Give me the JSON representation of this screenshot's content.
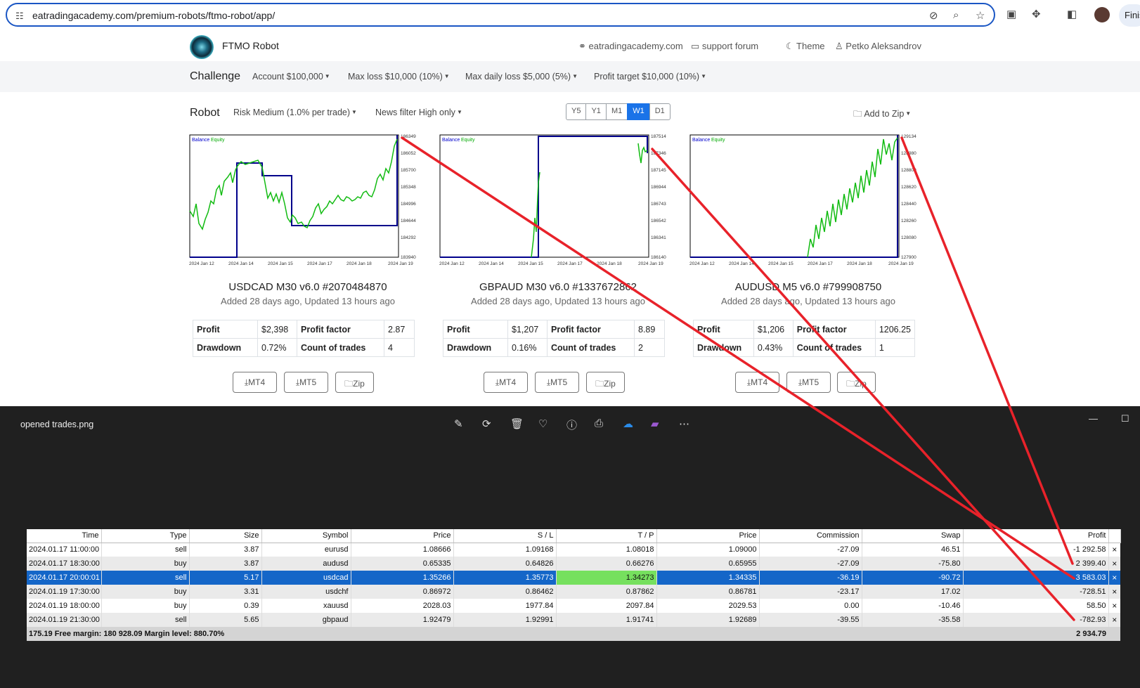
{
  "browser": {
    "url": "eatradingacademy.com/premium-robots/ftmo-robot/app/",
    "finish_label": "Finis"
  },
  "nav": {
    "brand": "FTMO Robot",
    "site_link": "eatradingacademy.com",
    "support_link": "support forum",
    "theme_link": "Theme",
    "user_link": "Petko Aleksandrov"
  },
  "challenge": {
    "title": "Challenge",
    "account": "Account $100,000",
    "max_loss": "Max loss $10,000 (10%)",
    "max_daily_loss": "Max daily loss $5,000 (5%)",
    "profit_target": "Profit target $10,000 (10%)"
  },
  "robot": {
    "title": "Robot",
    "risk": "Risk Medium (1.0% per trade)",
    "news_filter": "News filter High only",
    "timeframes": [
      "Y5",
      "Y1",
      "M1",
      "W1",
      "D1"
    ],
    "active_timeframe": "W1",
    "add_to_zip": "Add to Zip"
  },
  "strategies": [
    {
      "title": "USDCAD M30 v6.0 #2070484870",
      "subtitle": "Added 28 days ago, Updated 13 hours ago",
      "profit_label": "Profit",
      "profit": "$2,398",
      "pf_label": "Profit factor",
      "profit_factor": "2.87",
      "dd_label": "Drawdown",
      "drawdown": "0.72%",
      "count_label": "Count of trades",
      "count": "4",
      "chart_data": {
        "type": "line",
        "legend": [
          "Balance",
          "Equity"
        ],
        "y_ticks": [
          "186349",
          "186052",
          "185700",
          "185348",
          "184996",
          "184644",
          "184292",
          "183940"
        ],
        "x_ticks": [
          "2024 Jan 12",
          "2024 Jan 14",
          "2024 Jan 15",
          "2024 Jan 17",
          "2024 Jan 18",
          "2024 Jan 19"
        ]
      }
    },
    {
      "title": "GBPAUD M30 v6.0 #1337672862",
      "subtitle": "Added 28 days ago, Updated 13 hours ago",
      "profit_label": "Profit",
      "profit": "$1,207",
      "pf_label": "Profit factor",
      "profit_factor": "8.89",
      "dd_label": "Drawdown",
      "drawdown": "0.16%",
      "count_label": "Count of trades",
      "count": "2",
      "chart_data": {
        "type": "line",
        "legend": [
          "Balance",
          "Equity"
        ],
        "y_ticks": [
          "187514",
          "187346",
          "187145",
          "186944",
          "186743",
          "186542",
          "186341",
          "186140"
        ],
        "x_ticks": [
          "2024 Jan 12",
          "2024 Jan 14",
          "2024 Jan 15",
          "2024 Jan 17",
          "2024 Jan 18",
          "2024 Jan 19"
        ]
      }
    },
    {
      "title": "AUDUSD M5 v6.0 #799908750",
      "subtitle": "Added 28 days ago, Updated 13 hours ago",
      "profit_label": "Profit",
      "profit": "$1,206",
      "pf_label": "Profit factor",
      "profit_factor": "1206.25",
      "dd_label": "Drawdown",
      "drawdown": "0.43%",
      "count_label": "Count of trades",
      "count": "1",
      "chart_data": {
        "type": "line",
        "legend": [
          "Balance",
          "Equity"
        ],
        "y_ticks": [
          "129134",
          "128980",
          "128800",
          "128620",
          "128440",
          "128260",
          "128080",
          "127900"
        ],
        "x_ticks": [
          "2024 Jan 12",
          "2024 Jan 14",
          "2024 Jan 15",
          "2024 Jan 17",
          "2024 Jan 18",
          "2024 Jan 19"
        ]
      }
    }
  ],
  "download": {
    "mt4": "MT4",
    "mt5": "MT5",
    "zip": "Zip"
  },
  "viewer": {
    "filename": "opened trades.png"
  },
  "trades": {
    "columns": [
      "Time",
      "Type",
      "Size",
      "Symbol",
      "Price",
      "S / L",
      "T / P",
      "Price",
      "Commission",
      "Swap",
      "Profit"
    ],
    "rows": [
      [
        "2024.01.17 11:00:00",
        "sell",
        "3.87",
        "eurusd",
        "1.08666",
        "1.09168",
        "1.08018",
        "1.09000",
        "-27.09",
        "46.51",
        "-1 292.58"
      ],
      [
        "2024.01.17 18:30:00",
        "buy",
        "3.87",
        "audusd",
        "0.65335",
        "0.64826",
        "0.66276",
        "0.65955",
        "-27.09",
        "-75.80",
        "2 399.40"
      ],
      [
        "2024.01.17 20:00:01",
        "sell",
        "5.17",
        "usdcad",
        "1.35266",
        "1.35773",
        "1.34273",
        "1.34335",
        "-36.19",
        "-90.72",
        "3 583.03"
      ],
      [
        "2024.01.19 17:30:00",
        "buy",
        "3.31",
        "usdchf",
        "0.86972",
        "0.86462",
        "0.87862",
        "0.86781",
        "-23.17",
        "17.02",
        "-728.51"
      ],
      [
        "2024.01.19 18:00:00",
        "buy",
        "0.39",
        "xauusd",
        "2028.03",
        "1977.84",
        "2097.84",
        "2029.53",
        "0.00",
        "-10.46",
        "58.50"
      ],
      [
        "2024.01.19 21:30:00",
        "sell",
        "5.65",
        "gbpaud",
        "1.92479",
        "1.92991",
        "1.91741",
        "1.92689",
        "-39.55",
        "-35.58",
        "-782.93"
      ]
    ],
    "selected_row": 2,
    "summary": "175.19  Free margin: 180 928.09  Margin level: 880.70%",
    "total": "2 934.79",
    "close_glyph": "×"
  }
}
